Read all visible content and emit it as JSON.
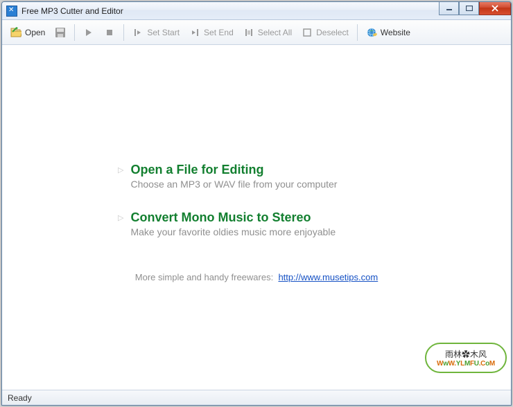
{
  "window": {
    "title": "Free MP3 Cutter and Editor"
  },
  "toolbar": {
    "open": "Open",
    "set_start": "Set Start",
    "set_end": "Set End",
    "select_all": "Select All",
    "deselect": "Deselect",
    "website": "Website"
  },
  "welcome": {
    "option1": {
      "title": "Open a File for Editing",
      "subtitle": "Choose an MP3 or WAV file from your computer"
    },
    "option2": {
      "title": "Convert Mono Music to Stereo",
      "subtitle": "Make your favorite oldies music more enjoyable"
    },
    "more_text": "More simple and handy freewares:",
    "more_url": "http://www.musetips.com"
  },
  "status": {
    "text": "Ready"
  },
  "watermark": {
    "cn": "雨林✿木风",
    "url_plain": "WwW.YLMFU.CoM"
  }
}
